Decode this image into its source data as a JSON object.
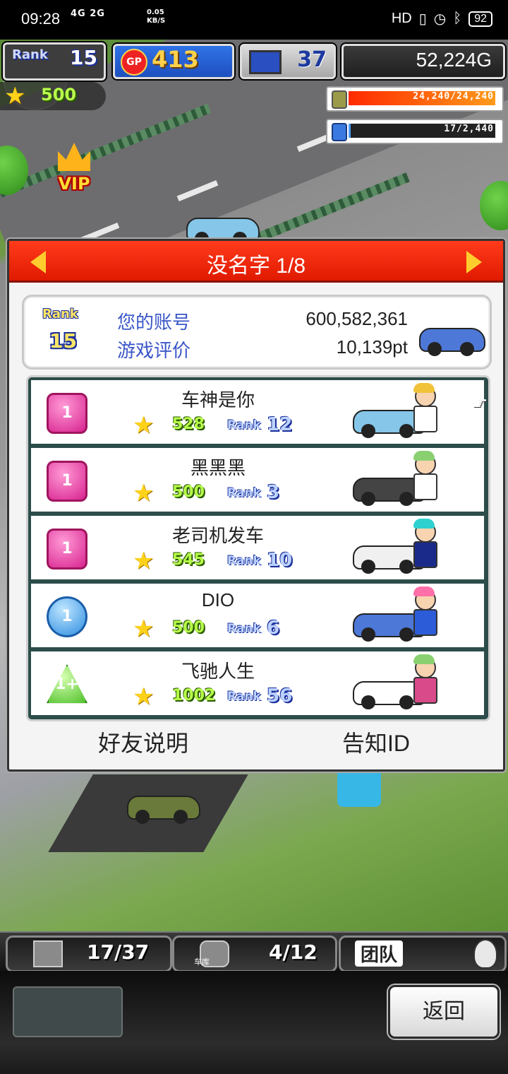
{
  "status_bar": {
    "time": "09:28",
    "network": "4G 2G",
    "speed": "0.05\nKB/S",
    "right_icons": "HD",
    "battery": "92"
  },
  "hud": {
    "rank_label": "Rank",
    "rank_value": "15",
    "gp_value": "413",
    "gp_coin": "GP",
    "pc_value": "37",
    "money": "52,224G",
    "stars": "500",
    "gauge_fuel": "24,240/24,240",
    "gauge_fuel_fraction": 1.0,
    "gauge_water": "17/2,440",
    "gauge_water_fraction": 0.007,
    "vip": "VIP"
  },
  "dialog": {
    "title": "没名字 1/8",
    "account": {
      "rank_label": "Rank",
      "rank_value": "15",
      "account_label": "您的账号",
      "account_value": "600,582,361",
      "rating_label": "游戏评价",
      "rating_value": "10,139pt"
    },
    "friends": [
      {
        "name": "车神是你",
        "badge": "1",
        "badge_style": "pink",
        "stars": "528",
        "rank_label": "Rank",
        "rank": "12",
        "car_color": "#86c6e8",
        "hair_color": "#f0c23a",
        "torso_color": "#ffffff"
      },
      {
        "name": "黑黑黑",
        "badge": "1",
        "badge_style": "pink",
        "stars": "500",
        "rank_label": "Rank",
        "rank": "3",
        "car_color": "#444444",
        "hair_color": "#8ad070",
        "torso_color": "#ffffff"
      },
      {
        "name": "老司机发车",
        "badge": "1",
        "badge_style": "pink",
        "stars": "545",
        "rank_label": "Rank",
        "rank": "10",
        "car_color": "#f0f0f0",
        "hair_color": "#2ed0d0",
        "torso_color": "#1a2a8a"
      },
      {
        "name": "DIO",
        "badge": "1",
        "badge_style": "blue",
        "stars": "500",
        "rank_label": "Rank",
        "rank": "6",
        "car_color": "#4d78d8",
        "hair_color": "#ff6fa8",
        "torso_color": "#2d5cd8"
      },
      {
        "name": "飞驰人生",
        "badge": "1+",
        "badge_style": "green",
        "stars": "1002",
        "rank_label": "Rank",
        "rank": "56",
        "car_color": "#ffffff",
        "hair_color": "#8ad070",
        "torso_color": "#d84a8a"
      }
    ],
    "help_label": "好友说明",
    "report_label": "告知ID"
  },
  "bottom_bar": {
    "tab1_count": "17/37",
    "tab2_count": "4/12",
    "tab2_sub": "车库",
    "team_label": "团队"
  },
  "actions": {
    "back_label": "返回"
  }
}
